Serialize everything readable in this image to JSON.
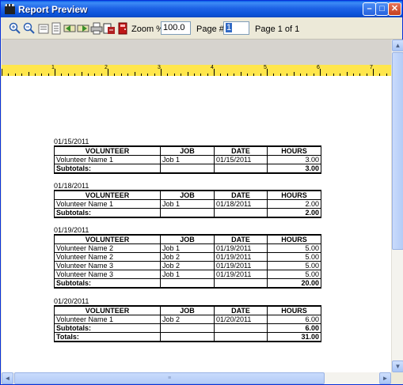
{
  "window": {
    "title": "Report Preview",
    "min_glyph": "–",
    "max_glyph": "□",
    "close_glyph": "✕"
  },
  "toolbar": {
    "tools": [
      {
        "name": "zoom-in-icon",
        "color": "#2a5db0"
      },
      {
        "name": "zoom-out-icon",
        "color": "#2a5db0"
      },
      {
        "name": "page-width-icon",
        "color": "#6b6b6b"
      },
      {
        "name": "whole-page-icon",
        "color": "#6b6b6b"
      },
      {
        "name": "previous-page-icon",
        "color": "#3a8f2a"
      },
      {
        "name": "next-page-icon",
        "color": "#3a8f2a"
      },
      {
        "name": "print-icon",
        "color": "#555555"
      },
      {
        "name": "export-icon",
        "color": "#b02020"
      },
      {
        "name": "exit-icon",
        "color": "#c01818"
      }
    ],
    "zoom_label": "Zoom %",
    "zoom_value": "100.0",
    "page_label": "Page #",
    "page_value": "1",
    "page_of": "Page 1 of 1"
  },
  "ruler": {
    "numbers": [
      "1",
      "2",
      "3",
      "4",
      "5",
      "6",
      "7"
    ]
  },
  "report": {
    "headers": [
      "VOLUNTEER",
      "JOB",
      "DATE",
      "HOURS"
    ],
    "subtotals_label": "Subtotals:",
    "totals_label": "Totals:",
    "total_hours": "31.00",
    "groups": [
      {
        "date": "01/15/2011",
        "rows": [
          [
            "Volunteer Name 1",
            "Job 1",
            "01/15/2011",
            "3.00"
          ]
        ],
        "subtotal": "3.00"
      },
      {
        "date": "01/18/2011",
        "rows": [
          [
            "Volunteer Name 1",
            "Job 1",
            "01/18/2011",
            "2.00"
          ]
        ],
        "subtotal": "2.00"
      },
      {
        "date": "01/19/2011",
        "rows": [
          [
            "Volunteer Name 2",
            "Job 1",
            "01/19/2011",
            "5.00"
          ],
          [
            "Volunteer Name 2",
            "Job 2",
            "01/19/2011",
            "5.00"
          ],
          [
            "Volunteer Name 3",
            "Job 2",
            "01/19/2011",
            "5.00"
          ],
          [
            "Volunteer Name 3",
            "Job 1",
            "01/19/2011",
            "5.00"
          ]
        ],
        "subtotal": "20.00"
      },
      {
        "date": "01/20/2011",
        "rows": [
          [
            "Volunteer Name 1",
            "Job 2",
            "01/20/2011",
            "6.00"
          ]
        ],
        "subtotal": "6.00"
      }
    ]
  },
  "scrollbars": {
    "up": "▲",
    "down": "▼",
    "left": "◄",
    "right": "►",
    "grip": "≡"
  }
}
